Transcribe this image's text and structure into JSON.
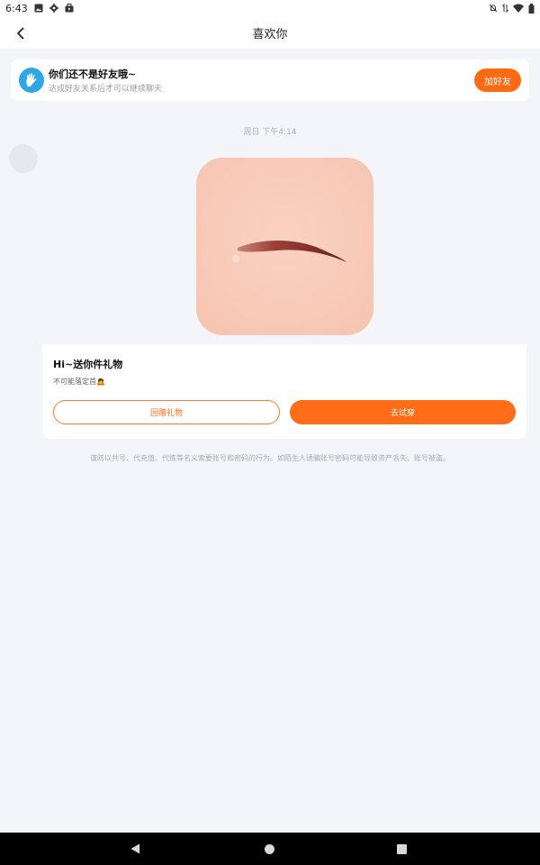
{
  "status_bar": {
    "time": "6:43",
    "icons": [
      "image-icon",
      "settings-gear-icon",
      "briefcase-icon",
      "notifications-off-icon",
      "data-arrows-icon",
      "wifi-icon",
      "battery-icon"
    ]
  },
  "header": {
    "title": "喜欢你",
    "back_icon": "chevron-left-icon"
  },
  "friend_banner": {
    "title": "你们还不是好友哦~",
    "subtitle": "达成好友关系后才可以继续聊天",
    "add_button": "加好友",
    "accent": "#ff6a13"
  },
  "chat": {
    "timestamp": "周日 下午4:14",
    "gift_card": {
      "image": "eyebrow-makeup-item",
      "title": "Hi~送你件礼物",
      "note": "不可能落定首🙇",
      "return_button": "回赠礼物",
      "try_button": "去试穿"
    },
    "notice": "谨防以共号、代充值、代练等名义索要账号和密码的行为。如陌生人诱骗账号密码可能导致资产丢失、账号被盗。"
  },
  "nav_bar": {
    "icons": [
      "nav-back-icon",
      "nav-home-icon",
      "nav-recents-icon"
    ]
  }
}
